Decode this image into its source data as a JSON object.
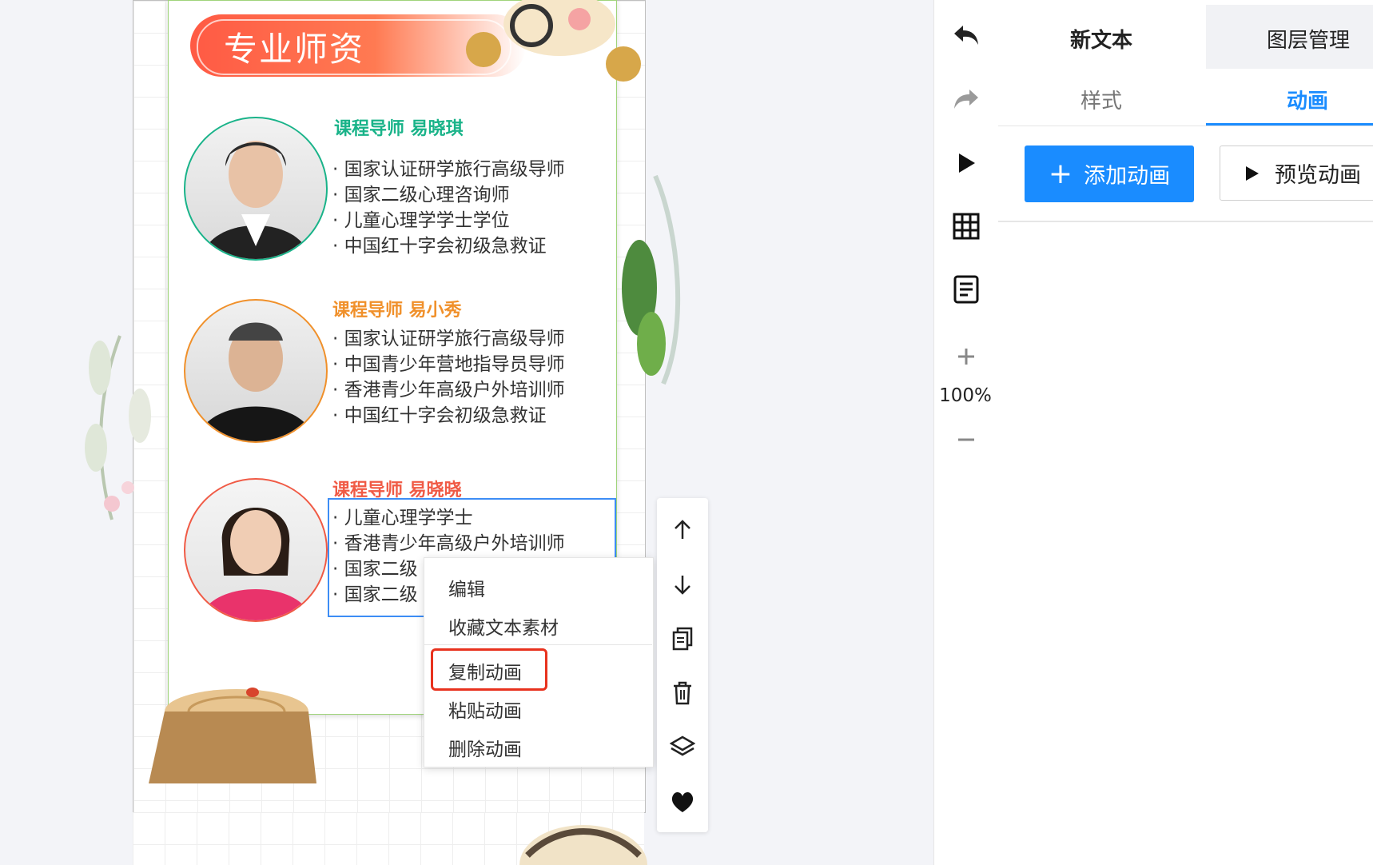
{
  "poster": {
    "banner_title": "专业师资",
    "teachers": [
      {
        "name": "课程导师 易晓琪",
        "color": "#19b389",
        "bullets": [
          "· 国家认证研学旅行高级导师",
          "· 国家二级心理咨询师",
          "· 儿童心理学学士学位",
          "· 中国红十字会初级急救证"
        ]
      },
      {
        "name": "课程导师 易小秀",
        "color": "#f0902a",
        "bullets": [
          "· 国家认证研学旅行高级导师",
          "· 中国青少年营地指导员导师",
          "· 香港青少年高级户外培训师",
          "· 中国红十字会初级急救证"
        ]
      },
      {
        "name": "课程导师 易晓晓",
        "color": "#f05a45",
        "bullets": [
          "· 儿童心理学学士",
          "· 香港青少年高级户外培训师",
          "· 国家二级",
          "· 国家二级"
        ]
      }
    ]
  },
  "context_menu": {
    "edit": "编辑",
    "favorite": "收藏文本素材",
    "copy_animation": "复制动画",
    "paste_animation": "粘贴动画",
    "delete_animation": "删除动画"
  },
  "toolbar": {
    "zoom": "100%"
  },
  "panel": {
    "tab_new_text": "新文本",
    "tab_layer": "图层管理",
    "subtab_style": "样式",
    "subtab_animation": "动画",
    "add_animation": "添加动画",
    "add_icon": "+",
    "preview_animation": "预览动画"
  },
  "colors": {
    "accent": "#1a8cff",
    "highlight": "#e8321e",
    "selection": "#3d8df5"
  }
}
